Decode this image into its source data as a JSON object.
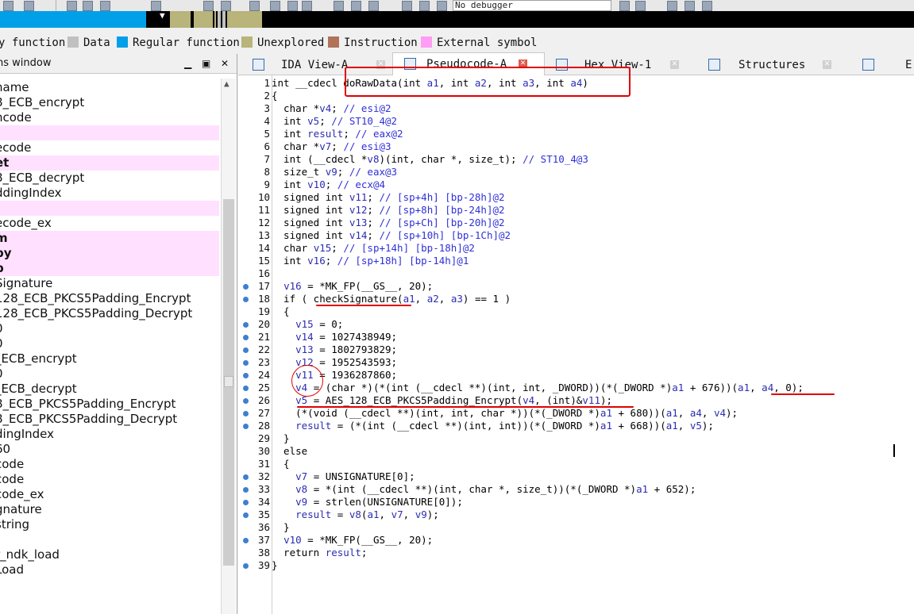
{
  "toolbar": {
    "debugger_select": "No debugger"
  },
  "legend": {
    "items": [
      {
        "label": "y function",
        "color": "#ffffff"
      },
      {
        "label": "Data",
        "color": "#c0c0c0"
      },
      {
        "label": "Regular function",
        "color": "#00a0e8"
      },
      {
        "label": "Unexplored",
        "color": "#b8b47a"
      },
      {
        "label": "Instruction",
        "color": "#b0735a"
      },
      {
        "label": "External symbol",
        "color": "#ff9cf4"
      }
    ]
  },
  "functions_window": {
    "title": "ns window",
    "column_header": "name",
    "items": [
      {
        "label": "8_ECB_encrypt",
        "style": ""
      },
      {
        "label": "ncode",
        "style": ""
      },
      {
        "label": "",
        "style": "hl"
      },
      {
        "label": "ecode",
        "style": ""
      },
      {
        "label": "et",
        "style": "hl bold"
      },
      {
        "label": "8_ECB_decrypt",
        "style": ""
      },
      {
        "label": "ddingIndex",
        "style": ""
      },
      {
        "label": ":",
        "style": "hl"
      },
      {
        "label": "ecode_ex",
        "style": ""
      },
      {
        "label": "m",
        "style": "hl bold"
      },
      {
        "label": "py",
        "style": "hl bold"
      },
      {
        "label": "p",
        "style": "hl bold"
      },
      {
        "label": "Signature",
        "style": ""
      },
      {
        "label": "128_ECB_PKCS5Padding_Encrypt",
        "style": ""
      },
      {
        "label": "128_ECB_PKCS5Padding_Decrypt",
        "style": ""
      },
      {
        "label": "0",
        "style": ""
      },
      {
        "label": "0",
        "style": ""
      },
      {
        "label": "_ECB_encrypt",
        "style": ""
      },
      {
        "label": "0",
        "style": ""
      },
      {
        "label": "_ECB_decrypt",
        "style": ""
      },
      {
        "label": "8_ECB_PKCS5Padding_Encrypt",
        "style": ""
      },
      {
        "label": "8_ECB_PKCS5Padding_Decrypt",
        "style": ""
      },
      {
        "label": "dingIndex",
        "style": ""
      },
      {
        "label": "60",
        "style": ""
      },
      {
        "label": "code",
        "style": ""
      },
      {
        "label": "code",
        "style": ""
      },
      {
        "label": "code_ex",
        "style": ""
      },
      {
        "label": "gnature",
        "style": ""
      },
      {
        "label": "string",
        "style": ""
      },
      {
        "label": "",
        "style": ""
      },
      {
        "label": "r_ndk_load",
        "style": ""
      },
      {
        "label": "Load",
        "style": ""
      }
    ]
  },
  "tabs": [
    {
      "label": "IDA View-A",
      "icon": "ida-view-icon",
      "active": false
    },
    {
      "label": "Pseudocode-A",
      "icon": "pseudocode-icon",
      "active": true
    },
    {
      "label": "Hex View-1",
      "icon": "hex-view-icon",
      "active": false
    },
    {
      "label": "Structures",
      "icon": "structures-icon",
      "active": false
    },
    {
      "label": "E",
      "icon": "enums-icon",
      "active": false
    }
  ],
  "code": [
    {
      "n": "1",
      "bp": false,
      "t": "int __cdecl doRawData(int a1, int a2, int a3, int a4)"
    },
    {
      "n": "2",
      "bp": false,
      "t": "{"
    },
    {
      "n": "3",
      "bp": false,
      "t": "  char *v4; // esi@2"
    },
    {
      "n": "4",
      "bp": false,
      "t": "  int v5; // ST10_4@2"
    },
    {
      "n": "5",
      "bp": false,
      "t": "  int result; // eax@2"
    },
    {
      "n": "6",
      "bp": false,
      "t": "  char *v7; // esi@3"
    },
    {
      "n": "7",
      "bp": false,
      "t": "  int (__cdecl *v8)(int, char *, size_t); // ST10_4@3"
    },
    {
      "n": "8",
      "bp": false,
      "t": "  size_t v9; // eax@3"
    },
    {
      "n": "9",
      "bp": false,
      "t": "  int v10; // ecx@4"
    },
    {
      "n": "10",
      "bp": false,
      "t": "  signed int v11; // [sp+4h] [bp-28h]@2"
    },
    {
      "n": "11",
      "bp": false,
      "t": "  signed int v12; // [sp+8h] [bp-24h]@2"
    },
    {
      "n": "12",
      "bp": false,
      "t": "  signed int v13; // [sp+Ch] [bp-20h]@2"
    },
    {
      "n": "13",
      "bp": false,
      "t": "  signed int v14; // [sp+10h] [bp-1Ch]@2"
    },
    {
      "n": "14",
      "bp": false,
      "t": "  char v15; // [sp+14h] [bp-18h]@2"
    },
    {
      "n": "15",
      "bp": false,
      "t": "  int v16; // [sp+18h] [bp-14h]@1"
    },
    {
      "n": "16",
      "bp": false,
      "t": ""
    },
    {
      "n": "17",
      "bp": true,
      "t": "  v16 = *MK_FP(__GS__, 20);"
    },
    {
      "n": "18",
      "bp": true,
      "t": "  if ( checkSignature(a1, a2, a3) == 1 )"
    },
    {
      "n": "19",
      "bp": false,
      "t": "  {"
    },
    {
      "n": "20",
      "bp": true,
      "t": "    v15 = 0;"
    },
    {
      "n": "21",
      "bp": true,
      "t": "    v14 = 1027438949;"
    },
    {
      "n": "22",
      "bp": true,
      "t": "    v13 = 1802793829;"
    },
    {
      "n": "23",
      "bp": true,
      "t": "    v12 = 1952543593;"
    },
    {
      "n": "24",
      "bp": true,
      "t": "    v11 = 1936287860;"
    },
    {
      "n": "25",
      "bp": true,
      "t": "    v4 = (char *)(*(int (__cdecl **)(int, int, _DWORD))(*(_DWORD *)a1 + 676))(a1, a4, 0);"
    },
    {
      "n": "26",
      "bp": true,
      "t": "    v5 = AES_128_ECB_PKCS5Padding_Encrypt(v4, (int)&v11);"
    },
    {
      "n": "27",
      "bp": true,
      "t": "    (*(void (__cdecl **)(int, int, char *))(*(_DWORD *)a1 + 680))(a1, a4, v4);"
    },
    {
      "n": "28",
      "bp": true,
      "t": "    result = (*(int (__cdecl **)(int, int))(*(_DWORD *)a1 + 668))(a1, v5);"
    },
    {
      "n": "29",
      "bp": false,
      "t": "  }"
    },
    {
      "n": "30",
      "bp": false,
      "t": "  else"
    },
    {
      "n": "31",
      "bp": false,
      "t": "  {"
    },
    {
      "n": "32",
      "bp": true,
      "t": "    v7 = UNSIGNATURE[0];"
    },
    {
      "n": "33",
      "bp": true,
      "t": "    v8 = *(int (__cdecl **)(int, char *, size_t))(*(_DWORD *)a1 + 652);"
    },
    {
      "n": "34",
      "bp": true,
      "t": "    v9 = strlen(UNSIGNATURE[0]);"
    },
    {
      "n": "35",
      "bp": true,
      "t": "    result = v8(a1, v7, v9);"
    },
    {
      "n": "36",
      "bp": false,
      "t": "  }"
    },
    {
      "n": "37",
      "bp": true,
      "t": "  v10 = *MK_FP(__GS__, 20);"
    },
    {
      "n": "38",
      "bp": false,
      "t": "  return result;"
    },
    {
      "n": "39",
      "bp": true,
      "t": "}"
    }
  ]
}
